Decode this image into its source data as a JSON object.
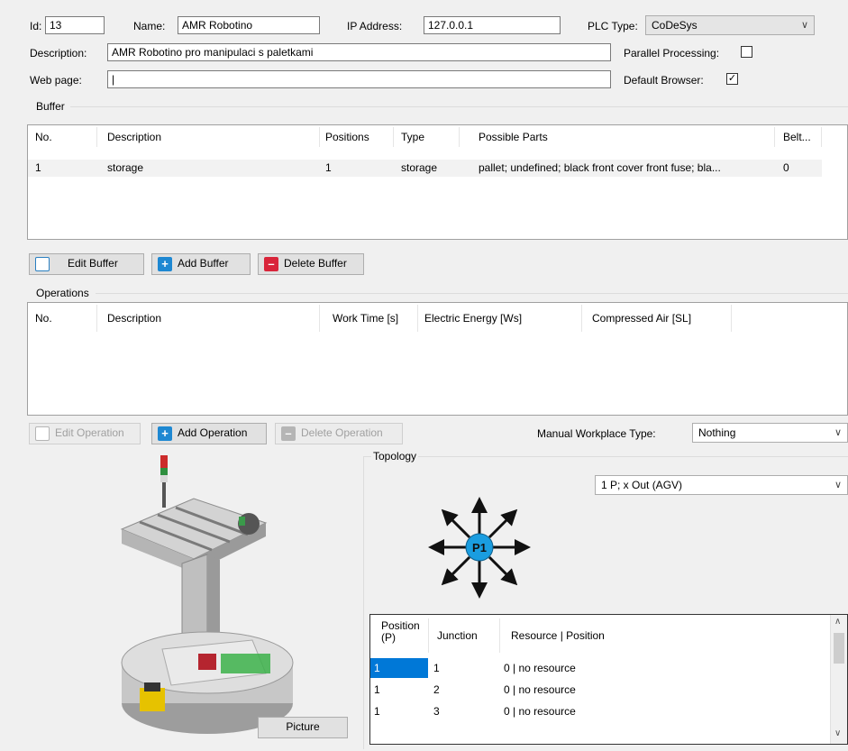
{
  "header": {
    "id_label": "Id:",
    "id_value": "13",
    "name_label": "Name:",
    "name_value": "AMR Robotino",
    "ip_label": "IP Address:",
    "ip_value": "127.0.0.1",
    "plc_label": "PLC Type:",
    "plc_value": "CoDeSys",
    "description_label": "Description:",
    "description_value": "AMR Robotino pro manipulaci s paletkami",
    "parallel_label": "Parallel Processing:",
    "parallel_checked": "",
    "webpage_label": "Web page:",
    "webpage_value": "|",
    "browser_label": "Default Browser:",
    "browser_checked": "✓"
  },
  "buffer": {
    "group_label": "Buffer",
    "columns": [
      "No.",
      "Description",
      "Positions",
      "Type",
      "Possible Parts",
      "Belt..."
    ],
    "rows": [
      [
        "1",
        "storage",
        "1",
        "storage",
        "pallet; undefined; black front cover front fuse; bla...",
        "0"
      ]
    ],
    "buttons": {
      "edit": "Edit Buffer",
      "add": "Add Buffer",
      "delete": "Delete Buffer"
    }
  },
  "operations": {
    "group_label": "Operations",
    "columns": [
      "No.",
      "Description",
      "Work Time [s]",
      "Electric Energy [Ws]",
      "Compressed Air [SL]"
    ],
    "rows": [],
    "buttons": {
      "edit": "Edit Operation",
      "add": "Add Operation",
      "delete": "Delete Operation"
    },
    "workplace_label": "Manual Workplace Type:",
    "workplace_value": "Nothing"
  },
  "picture": {
    "button_label": "Picture"
  },
  "topology": {
    "group_label": "Topology",
    "select_value": "1 P; x Out (AGV)",
    "node_label": "P1",
    "table_columns": [
      "Position\n(P)",
      "Junction",
      "Resource | Position"
    ],
    "table_rows": [
      [
        "1",
        "1",
        "0 | no resource"
      ],
      [
        "1",
        "2",
        "0 | no resource"
      ],
      [
        "1",
        "3",
        "0 | no resource"
      ]
    ]
  },
  "colors": {
    "selection": "#0078d7",
    "node": "#1a9de0",
    "accent_blue": "#1e88d2",
    "delete_red": "#d9253a"
  }
}
